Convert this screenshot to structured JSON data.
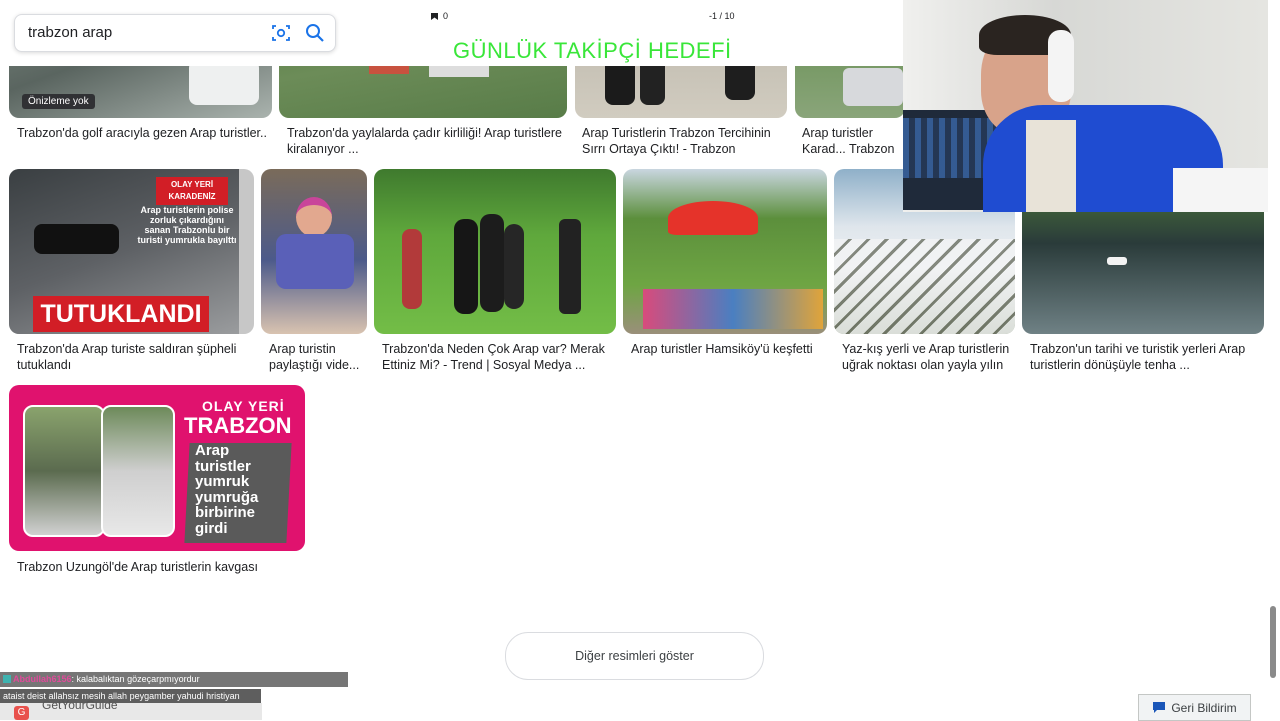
{
  "search": {
    "query": "trabzon arap",
    "lens_icon": "camera-lens-icon",
    "search_icon": "search-icon"
  },
  "overlay": {
    "title": "GÜNLÜK TAKİPÇİ HEDEFİ",
    "follower_count": "0",
    "goal_counter": "-1 / 10"
  },
  "row1": {
    "badge": "Önizleme yok",
    "captions": [
      "Trabzon'da golf aracıyla gezen Arap turistler...",
      "Trabzon'da yaylalarda çadır kirliliği! Arap turistlere kiralanıyor ...",
      "Arap Turistlerin Trabzon Tercihinin Sırrı Ortaya Çıktı! - Trabzon Güneba...",
      "Arap turistler Karad... Trabzon ve Rize'nin..."
    ]
  },
  "row2": {
    "tile1": {
      "tag_line1": "OLAY YERİ",
      "tag_line2": "KARADENİZ",
      "text": "Arap turistlerin polise zorluk çıkardığını sanan Trabzonlu bir turisti yumrukla bayılttı",
      "banner": "TUTUKLANDI"
    },
    "captions": [
      "Trabzon'da Arap turiste saldıran şüpheli tutuklandı",
      "Arap turistin paylaştığı vide...",
      "Trabzon'da Neden Çok Arap var? Merak Ettiniz Mi? - Trend | Sosyal Medya ...",
      "Arap turistler Hamsiköy'ü keşfetti",
      "Yaz-kış yerli ve Arap turistlerin uğrak noktası olan yayla yılın ...",
      "Trabzon'un tarihi ve turistik yerleri Arap turistlerin dönüşüyle tenha ..."
    ]
  },
  "row3": {
    "tile1": {
      "tag_line1": "OLAY YERİ",
      "tag_line2": "TRABZON",
      "text_lines": [
        "Arap",
        "turistler",
        "yumruk",
        "yumruğa",
        "birbirine",
        "girdi"
      ]
    },
    "caption": "Trabzon Uzungöl'de Arap turistlerin kavgası"
  },
  "more_button": "Diğer resimleri göster",
  "feedback_button": "Geri Bildirim",
  "chat": {
    "user": "Abdullah6156",
    "message1": ": kalabalıktan gözeçarpmıyordur",
    "message2": "ataist deist allahsız mesih allah peygamber yahudi hristiyan"
  },
  "bottom_ad": "GetYourGuide",
  "colors": {
    "overlay_green": "#39e639",
    "magenta": "#e0126e",
    "red": "#d21e26",
    "grass": "#5fa83c"
  }
}
